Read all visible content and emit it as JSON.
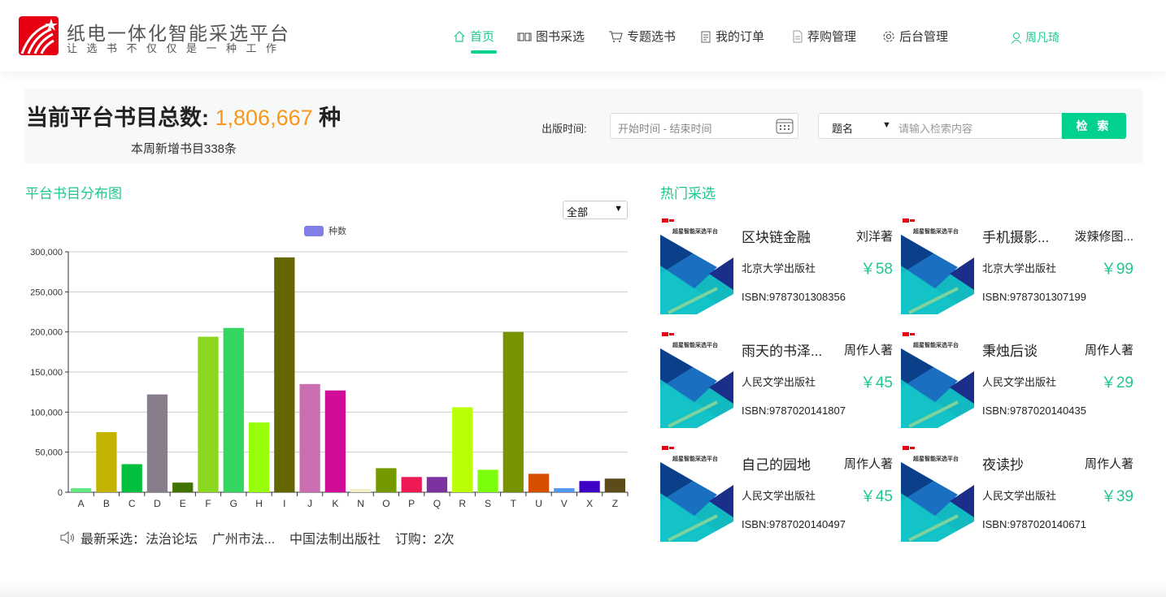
{
  "brand": {
    "title": "纸电一体化智能采选平台",
    "subtitle": "让选书不仅仅是一种工作",
    "logo_color": "#e60012"
  },
  "nav": [
    {
      "label": "首页",
      "icon": "home-icon",
      "active": true
    },
    {
      "label": "图书采选",
      "icon": "book-icon"
    },
    {
      "label": "专题选书",
      "icon": "cart-icon"
    },
    {
      "label": "我的订单",
      "icon": "clipboard-icon"
    },
    {
      "label": "荐购管理",
      "icon": "document-icon"
    },
    {
      "label": "后台管理",
      "icon": "gear-icon"
    }
  ],
  "user": {
    "name": "周凡琦"
  },
  "summary": {
    "label": "当前平台书目总数: ",
    "count": "1,806,667",
    "unit": " 种",
    "weekly": "本周新增书目338条"
  },
  "search": {
    "date_label": "出版时间:",
    "date_placeholder": "开始时间 - 结束时间",
    "field_select": "题名",
    "placeholder": "请输入检索内容",
    "button": "检 索"
  },
  "distribution": {
    "title": "平台书目分布图",
    "filter": "全部"
  },
  "chart_data": {
    "type": "bar",
    "legend": [
      "种数"
    ],
    "legend_placement": "top-center",
    "categories": [
      "A",
      "B",
      "C",
      "D",
      "E",
      "F",
      "G",
      "H",
      "I",
      "J",
      "K",
      "N",
      "O",
      "P",
      "Q",
      "R",
      "S",
      "T",
      "U",
      "V",
      "X",
      "Z"
    ],
    "values": [
      5000,
      75000,
      35000,
      122000,
      12000,
      194000,
      205000,
      87000,
      293000,
      135000,
      127000,
      4000,
      30000,
      19000,
      19000,
      106000,
      28000,
      200000,
      23000,
      5000,
      14000,
      17000
    ],
    "colors": [
      "#5ee87f",
      "#c4b200",
      "#00c03e",
      "#887d8c",
      "#417300",
      "#8ad91f",
      "#33d660",
      "#97ff09",
      "#666600",
      "#cb6db1",
      "#d10c98",
      "#f4f0c5",
      "#759a00",
      "#ee1a54",
      "#7c33a0",
      "#baff08",
      "#7cff0a",
      "#779300",
      "#d64f00",
      "#5197ef",
      "#3e00c7",
      "#5c4c1c"
    ],
    "yticks": [
      "0",
      "50,000",
      "100,000",
      "150,000",
      "200,000",
      "250,000",
      "300,000"
    ],
    "ylim": [
      0,
      300000
    ],
    "grid": true,
    "xlabel": "",
    "ylabel": ""
  },
  "ticker": {
    "label": "最新采选：",
    "title": "法治论坛",
    "buyer": "广州市法...",
    "publisher": "中国法制出版社",
    "orders": "订购：2次"
  },
  "hot": {
    "title": "热门采选",
    "cover_text": "超星智能采选平台",
    "books": [
      {
        "title": "区块链金融",
        "author": "刘洋著",
        "publisher": "北京大学出版社",
        "price": "￥58",
        "isbn": "ISBN:9787301308356"
      },
      {
        "title": "手机摄影...",
        "author": "泼辣修图...",
        "publisher": "北京大学出版社",
        "price": "￥99",
        "isbn": "ISBN:9787301307199"
      },
      {
        "title": "雨天的书泽...",
        "author": "周作人著",
        "publisher": "人民文学出版社",
        "price": "￥45",
        "isbn": "ISBN:9787020141807"
      },
      {
        "title": "秉烛后谈",
        "author": "周作人著",
        "publisher": "人民文学出版社",
        "price": "￥29",
        "isbn": "ISBN:9787020140435"
      },
      {
        "title": "自己的园地",
        "author": "周作人著",
        "publisher": "人民文学出版社",
        "price": "￥45",
        "isbn": "ISBN:9787020140497"
      },
      {
        "title": "夜读抄",
        "author": "周作人著",
        "publisher": "人民文学出版社",
        "price": "￥39",
        "isbn": "ISBN:9787020140671"
      }
    ]
  }
}
